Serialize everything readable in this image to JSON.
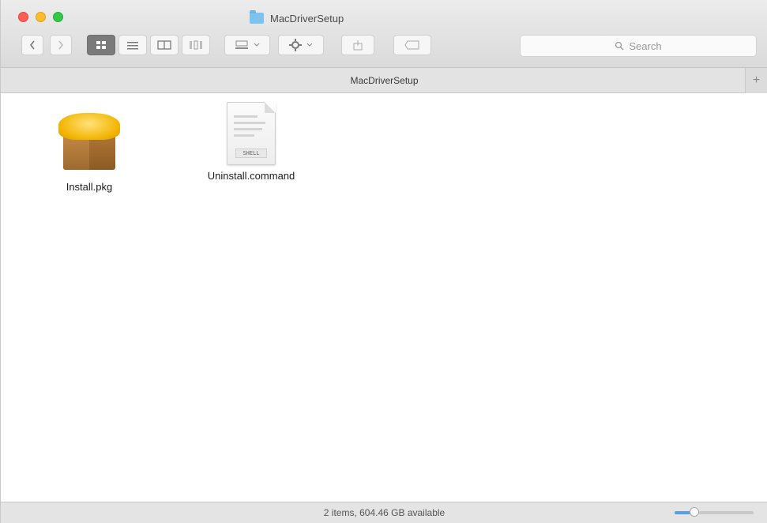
{
  "window": {
    "title": "MacDriverSetup"
  },
  "toolbar": {
    "back_icon": "chevron-left-icon",
    "forward_icon": "chevron-right-icon",
    "view_icons": "view-icons-icon",
    "view_list": "view-list-icon",
    "view_columns": "view-columns-icon",
    "view_gallery": "view-gallery-icon",
    "arrange_icon": "arrange-icon",
    "action_icon": "gear-icon",
    "share_icon": "share-icon",
    "tags_icon": "tag-icon"
  },
  "search": {
    "placeholder": "Search"
  },
  "pathbar": {
    "label": "MacDriverSetup"
  },
  "files": [
    {
      "name": "Install.pkg",
      "icon": "package-icon"
    },
    {
      "name": "Uninstall.command",
      "icon": "command-file-icon",
      "badge": "SHELL"
    }
  ],
  "statusbar": {
    "text": "2 items, 604.46 GB available",
    "zoom_level": 0.25
  },
  "colors": {
    "close": "#fc5f57",
    "minimize": "#fdbc2e",
    "maximize": "#33c748",
    "folder": "#7ec3f0",
    "accent": "#5a9fe6"
  }
}
